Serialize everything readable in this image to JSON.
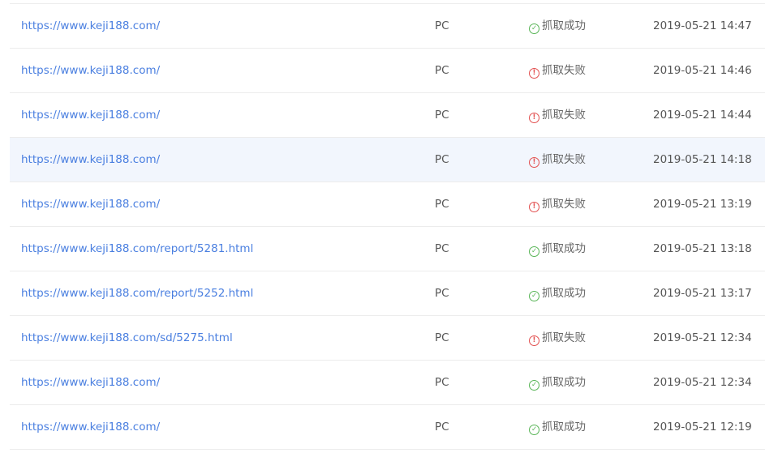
{
  "rows": [
    {
      "url": "https://www.keji188.com/",
      "device": "PC",
      "status": "抓取成功",
      "status_type": "success",
      "status_icon": "check-circle-icon",
      "time": "2019-05-21 14:47"
    },
    {
      "url": "https://www.keji188.com/",
      "device": "PC",
      "status": "抓取失败",
      "status_type": "fail",
      "status_icon": "exclamation-circle-icon",
      "time": "2019-05-21 14:46"
    },
    {
      "url": "https://www.keji188.com/",
      "device": "PC",
      "status": "抓取失败",
      "status_type": "fail",
      "status_icon": "exclamation-circle-icon",
      "time": "2019-05-21 14:44"
    },
    {
      "url": "https://www.keji188.com/",
      "device": "PC",
      "status": "抓取失败",
      "status_type": "fail",
      "status_icon": "exclamation-circle-icon",
      "time": "2019-05-21 14:18"
    },
    {
      "url": "https://www.keji188.com/",
      "device": "PC",
      "status": "抓取失败",
      "status_type": "fail",
      "status_icon": "exclamation-circle-icon",
      "time": "2019-05-21 13:19"
    },
    {
      "url": "https://www.keji188.com/report/5281.html",
      "device": "PC",
      "status": "抓取成功",
      "status_type": "success",
      "status_icon": "check-circle-icon",
      "time": "2019-05-21 13:18"
    },
    {
      "url": "https://www.keji188.com/report/5252.html",
      "device": "PC",
      "status": "抓取成功",
      "status_type": "success",
      "status_icon": "check-circle-icon",
      "time": "2019-05-21 13:17"
    },
    {
      "url": "https://www.keji188.com/sd/5275.html",
      "device": "PC",
      "status": "抓取失败",
      "status_type": "fail",
      "status_icon": "exclamation-circle-icon",
      "time": "2019-05-21 12:34"
    },
    {
      "url": "https://www.keji188.com/",
      "device": "PC",
      "status": "抓取成功",
      "status_type": "success",
      "status_icon": "check-circle-icon",
      "time": "2019-05-21 12:34"
    },
    {
      "url": "https://www.keji188.com/",
      "device": "PC",
      "status": "抓取成功",
      "status_type": "success",
      "status_icon": "check-circle-icon",
      "time": "2019-05-21 12:19"
    }
  ],
  "colors": {
    "link": "#4a7fe0",
    "success": "#57b455",
    "fail": "#e24f4f",
    "row_hover": "#f2f6fd"
  }
}
